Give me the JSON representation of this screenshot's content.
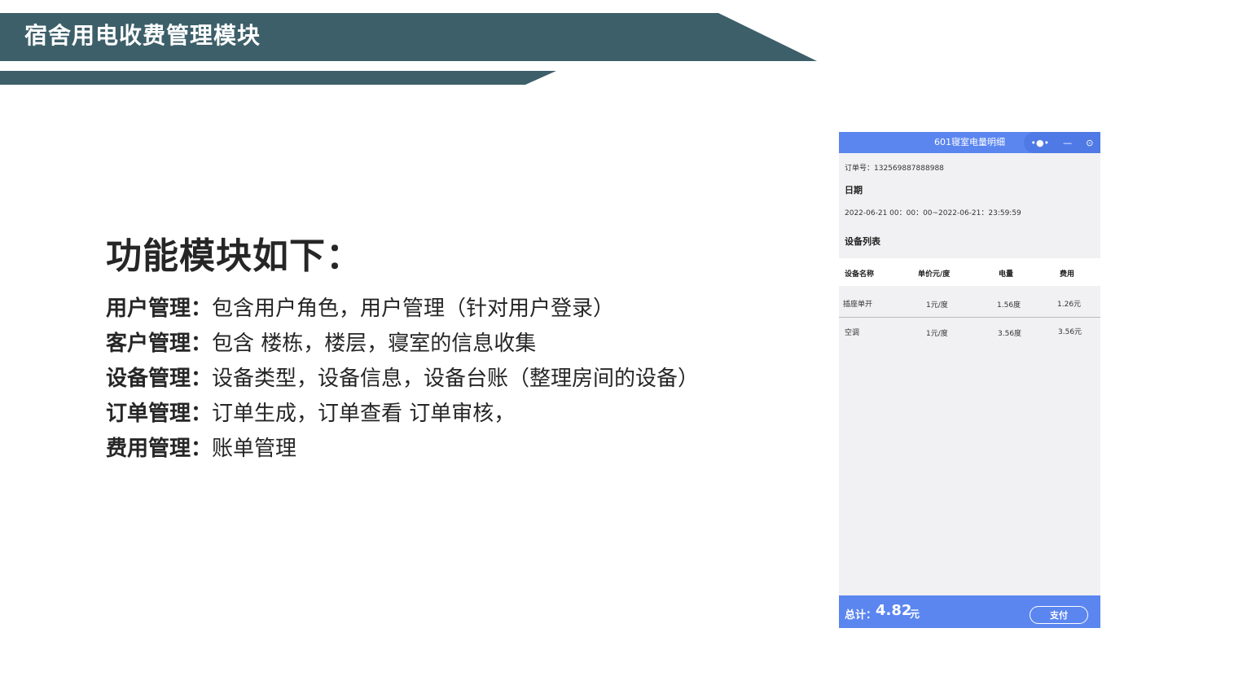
{
  "slide": {
    "title": "宿舍用电收费管理模块",
    "heading": "功能模块如下："
  },
  "modules": [
    {
      "name": "用户管理：",
      "desc": "包含用户角色，用户管理（针对用户登录）"
    },
    {
      "name": "客户管理：",
      "desc": "包含 楼栋，楼层，寝室的信息收集"
    },
    {
      "name": "设备管理：",
      "desc": "设备类型，设备信息，设备台账（整理房间的设备）"
    },
    {
      "name": "订单管理：",
      "desc": "订单生成，订单查看 订单审核，"
    },
    {
      "name": "费用管理：",
      "desc": "账单管理"
    }
  ],
  "phone": {
    "title": "601寝室电量明细",
    "capsule": {
      "more": "•●•",
      "minimize": "—",
      "close": "⊙"
    },
    "order_no": "订单号：132569887888988",
    "date_label": "日期",
    "date_range": "2022-06-21 00：00：00~2022-06-21：23:59:59",
    "device_list_label": "设备列表",
    "table": {
      "headers": [
        "设备名称",
        "单价元/度",
        "电量",
        "费用"
      ],
      "rows": [
        [
          "插座单开",
          "1元/度",
          "1.56度",
          "1.26元"
        ],
        [
          "空调",
          "1元/度",
          "3.56度",
          "3.56元"
        ]
      ]
    },
    "footer": {
      "total_label": "总计：",
      "total_value": "4.82",
      "total_unit": "元",
      "pay_label": "支付"
    },
    "colors": {
      "accent": "#5b86f0",
      "banner": "#3d5f69"
    }
  }
}
